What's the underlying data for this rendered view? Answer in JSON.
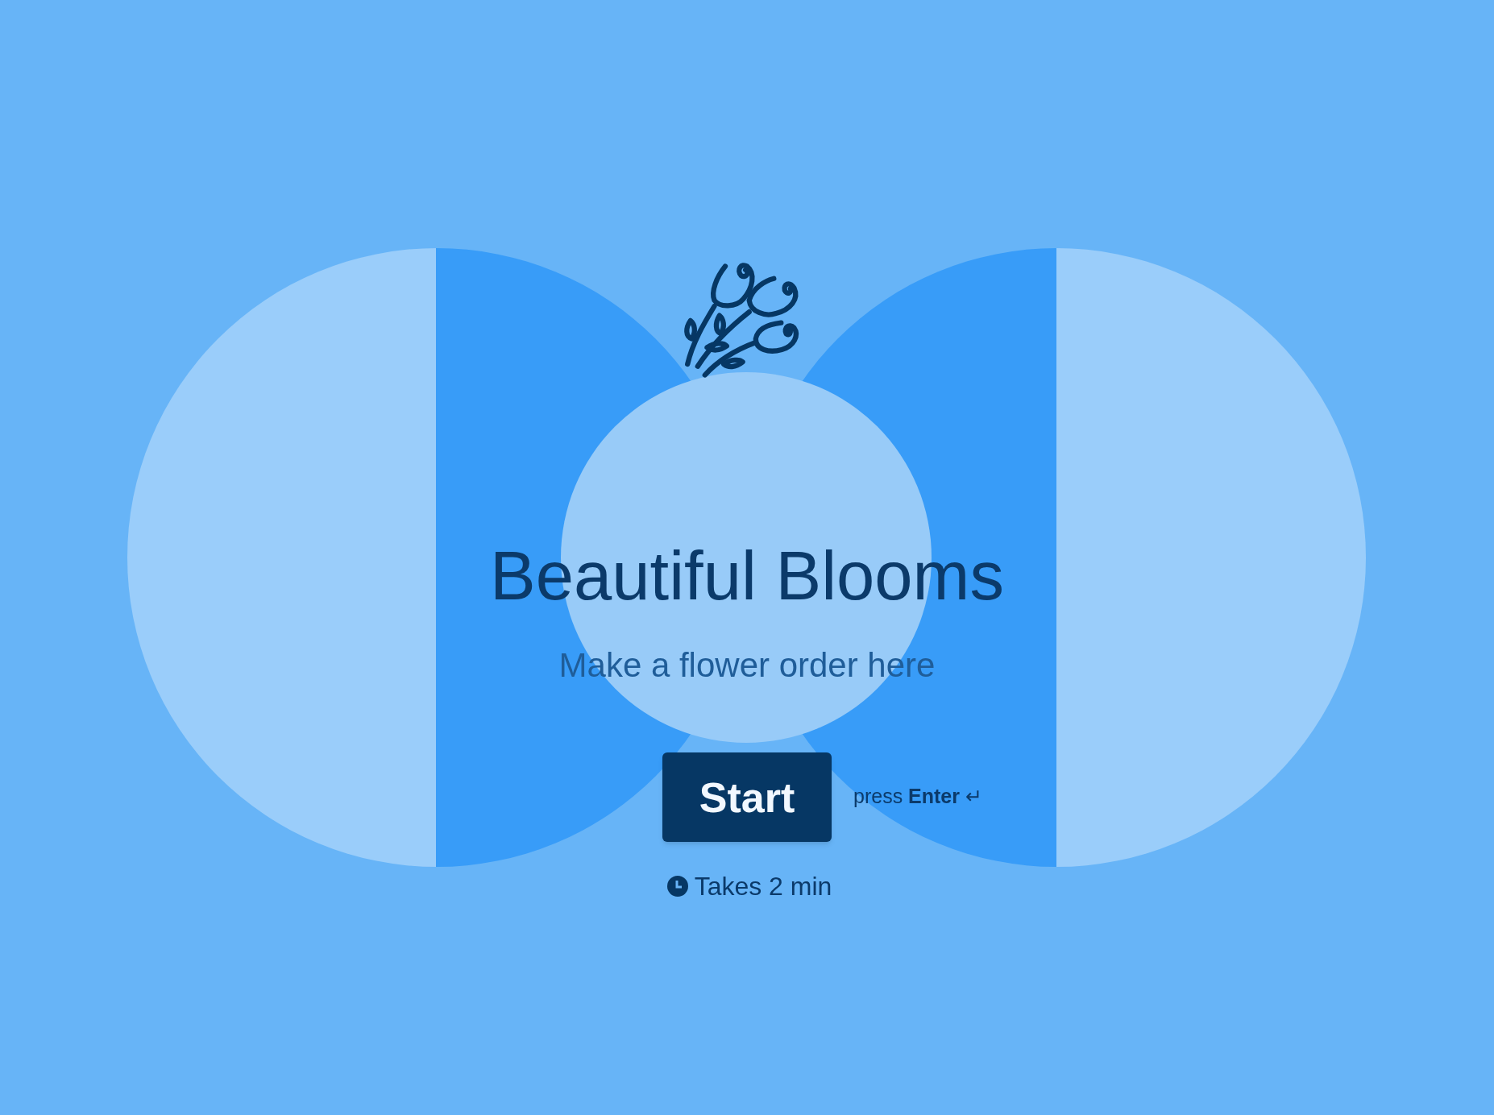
{
  "welcome": {
    "title": "Beautiful Blooms",
    "subtitle": "Make a flower order here",
    "button": "Start",
    "hint": "press **Enter** ↵",
    "duration": "Takes 2 min"
  }
}
